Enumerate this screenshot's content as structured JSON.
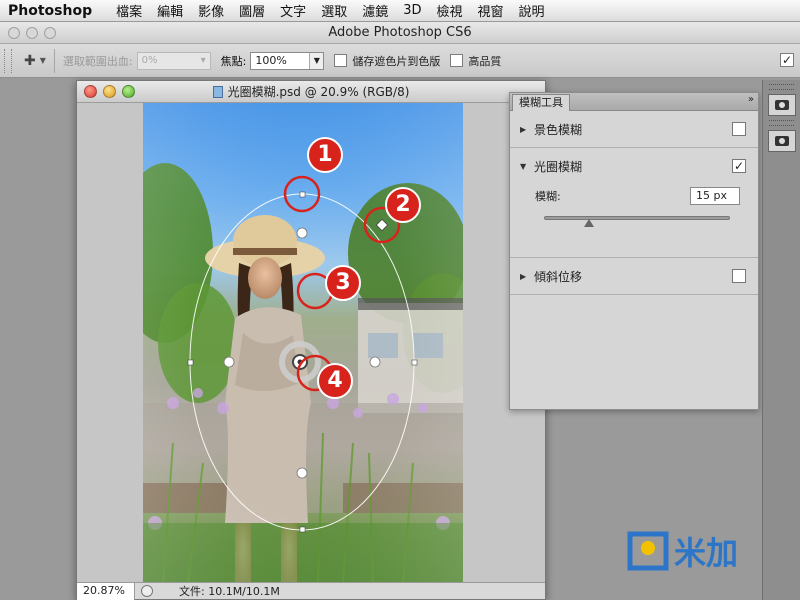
{
  "menubar": {
    "app_name": "Photoshop",
    "items": [
      "檔案",
      "編輯",
      "影像",
      "圖層",
      "文字",
      "選取",
      "濾鏡",
      "3D",
      "檢視",
      "視窗",
      "說明"
    ]
  },
  "app_window": {
    "title": "Adobe Photoshop CS6"
  },
  "options_bar": {
    "selection_bleed_label": "選取範圍出血:",
    "selection_bleed_value": "0%",
    "focus_label": "焦點:",
    "focus_value": "100%",
    "save_mask_label": "儲存遮色片到色版",
    "high_quality_label": "高品質"
  },
  "document": {
    "title": "光圈模糊.psd @ 20.9% (RGB/8)",
    "zoom": "20.87%",
    "status": "文件: 10.1M/10.1M"
  },
  "overlay_markers": [
    "1",
    "2",
    "3",
    "4"
  ],
  "blur_panel": {
    "tab_label": "模糊工具",
    "menu_icon": "»",
    "field_blur_label": "景色模糊",
    "field_blur_checked": false,
    "iris_blur_label": "光圈模糊",
    "iris_blur_checked": true,
    "blur_amount_label": "模糊:",
    "blur_amount_value": "15 px",
    "blur_slider_fraction": 0.24,
    "tilt_shift_label": "傾斜位移",
    "tilt_shift_checked": false
  },
  "watermark": {
    "text": "米加",
    "colors": {
      "accent": "#1a6fd0",
      "yellow": "#f2c200"
    }
  },
  "colors": {
    "marker_red": "#d8231c"
  }
}
